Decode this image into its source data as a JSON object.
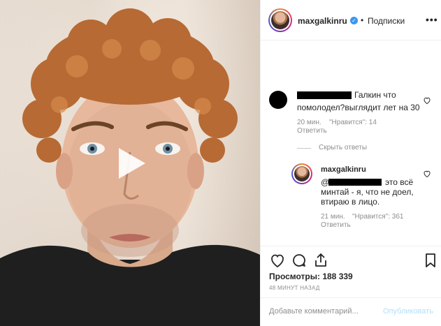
{
  "post": {
    "username": "maxgalkinru",
    "separator": "•",
    "follow_label": "Подписки",
    "more_label": "•••"
  },
  "comments": [
    {
      "text_after_redaction": "Галкин что",
      "text_line2": "помолодел?выглядит лет на 30",
      "time": "20 мин.",
      "likes": "\"Нравится\": 14",
      "reply": "Ответить"
    }
  ],
  "hide_replies": "Скрыть ответы",
  "reply_comment": {
    "username": "maxgalkinru",
    "at": "@",
    "text_line1": "это всё",
    "text_line2": "минтай - я, что не доел,",
    "text_line3": "втираю в лицо.",
    "time": "21 мин.",
    "likes": "\"Нравится\": 361",
    "reply": "Ответить"
  },
  "stats": {
    "views": "Просмотры: 188 339",
    "time_ago": "48 МИНУТ НАЗАД"
  },
  "compose": {
    "placeholder": "Добавьте комментарий...",
    "publish": "Опубликовать"
  },
  "icons": [
    "heart-icon",
    "comment-icon",
    "share-icon",
    "bookmark-icon",
    "play-icon",
    "verified-icon"
  ]
}
